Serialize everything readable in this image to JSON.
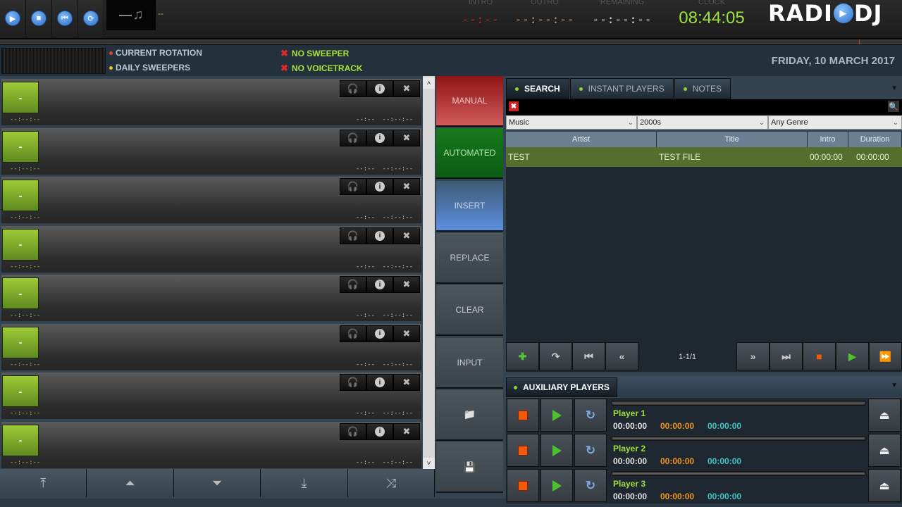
{
  "transport": {
    "buttons": [
      {
        "name": "play-button",
        "icon": "play-icon",
        "glyph": "▶"
      },
      {
        "name": "stop-button",
        "icon": "stop-icon",
        "glyph": "■"
      },
      {
        "name": "previous-button",
        "icon": "skip-back-icon",
        "glyph": "⏮"
      },
      {
        "name": "loop-button",
        "icon": "repeat-icon",
        "glyph": "⟳"
      }
    ],
    "now_playing_icon": "♫",
    "now_playing_title": "--"
  },
  "timers": {
    "intro": {
      "label": "INTRO",
      "value": "--:--",
      "color": "#d42020"
    },
    "outro": {
      "label": "OUTRO",
      "value": "--:--:--",
      "color": "#e0985a"
    },
    "remaining": {
      "label": "REMAINING",
      "value": "--:--:--",
      "color": "#e8e8e8"
    },
    "clock": {
      "label": "CLOCK",
      "value": "08:44:05",
      "color": "#9ce23e"
    }
  },
  "logo": {
    "left": "RADI",
    "right": "DJ",
    "glyph": "▶"
  },
  "status": {
    "rotation": {
      "label": "CURRENT ROTATION",
      "dot_color": "#e0452d"
    },
    "sweepers": {
      "label": "DAILY SWEEPERS",
      "dot_color": "#e6c12a"
    },
    "no_sweeper": {
      "label": "NO SWEEPER",
      "icon": "✖"
    },
    "no_voicetrack": {
      "label": "NO VOICETRACK",
      "icon": "✖"
    },
    "date": "FRIDAY, 10 MARCH 2017"
  },
  "playlist": {
    "tracks": [
      {
        "thumb": "-",
        "start": "--:--:--",
        "intro": "--:--",
        "duration": "--:--:--"
      },
      {
        "thumb": "-",
        "start": "--:--:--",
        "intro": "--:--",
        "duration": "--:--:--"
      },
      {
        "thumb": "-",
        "start": "--:--:--",
        "intro": "--:--",
        "duration": "--:--:--"
      },
      {
        "thumb": "-",
        "start": "--:--:--",
        "intro": "--:--",
        "duration": "--:--:--"
      },
      {
        "thumb": "-",
        "start": "--:--:--",
        "intro": "--:--",
        "duration": "--:--:--"
      },
      {
        "thumb": "-",
        "start": "--:--:--",
        "intro": "--:--",
        "duration": "--:--:--"
      },
      {
        "thumb": "-",
        "start": "--:--:--",
        "intro": "--:--",
        "duration": "--:--:--"
      },
      {
        "thumb": "-",
        "start": "--:--:--",
        "intro": "--:--",
        "duration": "--:--:--"
      }
    ],
    "track_buttons": {
      "preview": "🎧",
      "info": "i",
      "remove": "✖"
    },
    "scroll_up": "˄",
    "scroll_down": "˅",
    "controls": [
      {
        "name": "move-top-button",
        "icon": "move-top-icon",
        "glyph": "⤒"
      },
      {
        "name": "move-up-button",
        "icon": "move-up-icon",
        "glyph": "⏶"
      },
      {
        "name": "move-down-button",
        "icon": "move-down-icon",
        "glyph": "⏷"
      },
      {
        "name": "move-bottom-button",
        "icon": "move-bottom-icon",
        "glyph": "⤓"
      },
      {
        "name": "shuffle-button",
        "icon": "shuffle-icon",
        "glyph": "⤨"
      }
    ]
  },
  "modes": [
    {
      "label": "MANUAL",
      "bg": "linear-gradient(#8e1414,#d25b5b)",
      "color": "#f0c8c8"
    },
    {
      "label": "AUTOMATED",
      "bg": "linear-gradient(#167a1c,#0c5c13)",
      "color": "#b9e6b2"
    },
    {
      "label": "INSERT",
      "bg": "linear-gradient(#3e5a74,#5c8fe0)",
      "color": "#c4d3e6"
    },
    {
      "label": "REPLACE",
      "bg": "",
      "color": "#c4cad0"
    },
    {
      "label": "CLEAR",
      "bg": "",
      "color": "#c4cad0"
    },
    {
      "label": "INPUT",
      "bg": "",
      "color": "#c4cad0"
    },
    {
      "label": "",
      "icon": "folder-icon",
      "glyph": "📁",
      "bg": "",
      "color": "#c4cad0"
    },
    {
      "label": "",
      "icon": "save-icon",
      "glyph": "💾",
      "bg": "",
      "color": "#c4cad0"
    }
  ],
  "tabs": [
    {
      "label": "SEARCH",
      "active": true
    },
    {
      "label": "INSTANT PLAYERS",
      "active": false
    },
    {
      "label": "NOTES",
      "active": false
    }
  ],
  "search": {
    "value": "",
    "placeholder": "",
    "clear_glyph": "✖",
    "search_glyph": "🔍"
  },
  "filters": {
    "type": "Music",
    "year": "2000s",
    "genre": "Any Genre"
  },
  "results": {
    "columns": [
      "Artist",
      "Title",
      "Intro",
      "Duration"
    ],
    "rows": [
      {
        "artist": "TEST",
        "title": "TEST FILE",
        "intro": "00:00:00",
        "duration": "00:00:00"
      }
    ]
  },
  "nav": {
    "left": [
      {
        "name": "add-button",
        "icon": "plus-icon",
        "glyph": "✚",
        "color": "#57c53a"
      },
      {
        "name": "redirect-button",
        "icon": "redirect-icon",
        "glyph": "↷",
        "color": "#ccc"
      },
      {
        "name": "first-page-button",
        "icon": "first-icon",
        "glyph": "⏮",
        "color": "#ccc"
      },
      {
        "name": "prev-page-button",
        "icon": "rewind-icon",
        "glyph": "«",
        "color": "#ccc"
      }
    ],
    "page": "1-1/1",
    "right": [
      {
        "name": "next-page-button",
        "icon": "fast-forward-icon",
        "glyph": "»",
        "color": "#ccc"
      },
      {
        "name": "last-page-button",
        "icon": "last-icon",
        "glyph": "⏭",
        "color": "#ccc"
      },
      {
        "name": "preview-stop-button",
        "icon": "stop-icon",
        "glyph": "■",
        "color": "#f25a0a"
      },
      {
        "name": "preview-play-button",
        "icon": "play-icon",
        "glyph": "▶",
        "color": "#4cc22e"
      },
      {
        "name": "preview-skip-button",
        "icon": "skip-icon",
        "glyph": "⏩",
        "color": "#aaa"
      }
    ]
  },
  "aux": {
    "title": "AUXILIARY PLAYERS",
    "players": [
      {
        "name": "Player 1",
        "elapsed": "00:00:00",
        "remaining": "00:00:00",
        "duration": "00:00:00"
      },
      {
        "name": "Player 2",
        "elapsed": "00:00:00",
        "remaining": "00:00:00",
        "duration": "00:00:00"
      },
      {
        "name": "Player 3",
        "elapsed": "00:00:00",
        "remaining": "00:00:00",
        "duration": "00:00:00"
      }
    ],
    "colors": {
      "elapsed": "#e6e6e6",
      "remaining": "#f0961e",
      "duration": "#3ec6c9"
    },
    "loop_glyph": "↻",
    "eject_glyph": "⏏"
  }
}
